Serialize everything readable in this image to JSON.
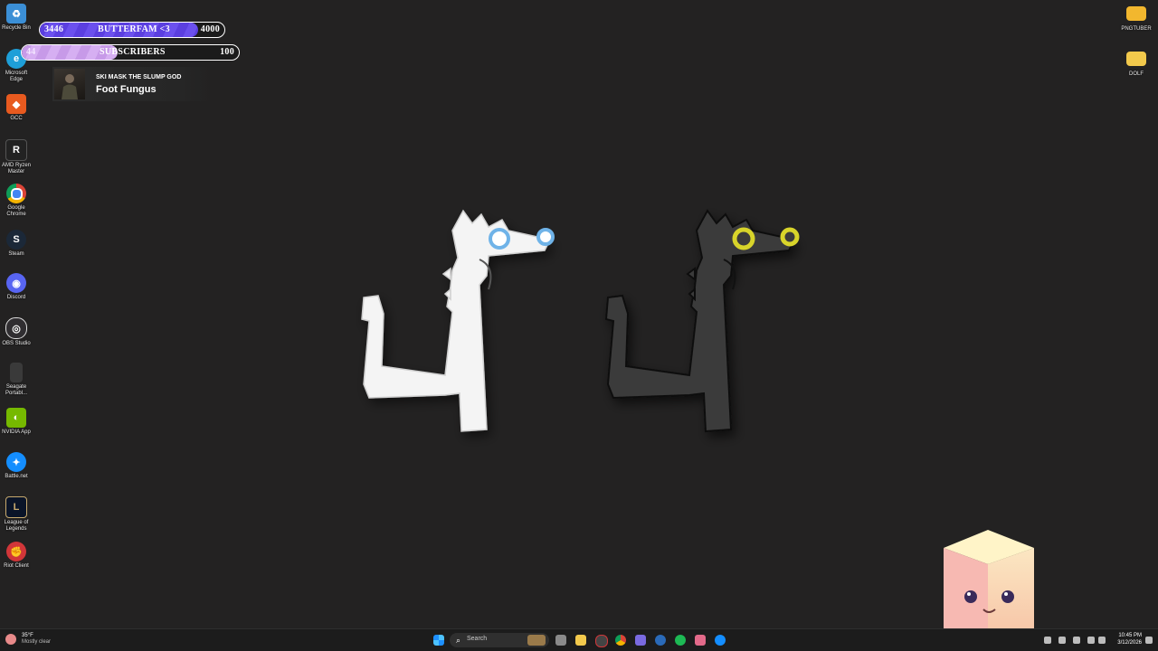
{
  "desktop_icons": [
    {
      "id": "recycle-bin",
      "label": "Recycle Bin",
      "color": "#3b8fd6",
      "glyph": "♻"
    },
    {
      "id": "microsoft-edge",
      "label": "Microsoft\nEdge",
      "color": "#1e9fd8",
      "glyph": "e"
    },
    {
      "id": "gcc",
      "label": "GCC",
      "color": "#e85a1f",
      "glyph": "◆"
    },
    {
      "id": "amd-ryzen-master",
      "label": "AMD Ryzen\nMaster",
      "color": "#222222",
      "glyph": "R"
    },
    {
      "id": "google-chrome",
      "label": "Google\nChrome",
      "color": "#dd4b39",
      "glyph": "●"
    },
    {
      "id": "steam",
      "label": "Steam",
      "color": "#1b2838",
      "glyph": "S"
    },
    {
      "id": "discord",
      "label": "Discord",
      "color": "#5865f2",
      "glyph": "◉"
    },
    {
      "id": "obs-studio",
      "label": "OBS Studio",
      "color": "#302e31",
      "glyph": "◎"
    },
    {
      "id": "seagate-portable",
      "label": "Seagate\nPortabl...",
      "color": "#3a3a3a",
      "glyph": ""
    },
    {
      "id": "nvidia-app",
      "label": "NVIDIA App",
      "color": "#76b900",
      "glyph": "◐"
    },
    {
      "id": "battle-net",
      "label": "Battle.net",
      "color": "#148eff",
      "glyph": "✦"
    },
    {
      "id": "league-of-legends",
      "label": "League of\nLegends",
      "color": "#0a1428",
      "glyph": "L"
    },
    {
      "id": "riot-client",
      "label": "Riot Client",
      "color": "#d13639",
      "glyph": "✊"
    }
  ],
  "right_icons": [
    {
      "id": "pngtuber-folder",
      "label": "PNGTUBER",
      "color": "#f2b72e"
    },
    {
      "id": "dolf-folder",
      "label": "DOLF",
      "color": "#f2c94c"
    }
  ],
  "goals": [
    {
      "current": "3446",
      "title": "BUTTERFAM <3",
      "target": "4000",
      "progress": 0.86,
      "color": "#5b3fe0"
    },
    {
      "current": "44",
      "title": "SUBSCRIBERS",
      "target": "100",
      "progress": 0.44,
      "color": "#c79ae8"
    }
  ],
  "now_playing": {
    "artist": "SKI MASK THE SLUMP GOD",
    "title": "Foot Fungus"
  },
  "weather": {
    "temp": "35°F",
    "condition": "Mostly clear"
  },
  "taskbar": {
    "search_placeholder": "Search"
  },
  "clock": {
    "time": "10:45 PM",
    "date": "3/12/2026"
  }
}
